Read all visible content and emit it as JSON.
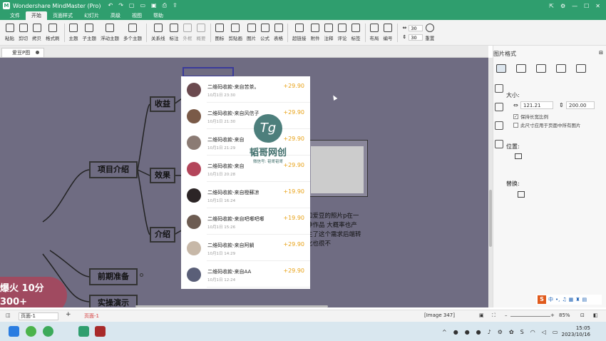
{
  "window": {
    "title": "Wondershare MindMaster (Pro)",
    "logo_letter": "M"
  },
  "menu": {
    "tabs": [
      "文件",
      "开始",
      "页面样式",
      "幻灯片",
      "高级",
      "视图",
      "帮助"
    ],
    "active": "开始"
  },
  "ribbon": {
    "groups": [
      [
        "粘贴",
        "剪切",
        "拷贝",
        "格式刷"
      ],
      [
        "主题",
        "子主题",
        "浮动主题",
        "多个主题"
      ],
      [
        "关系线",
        "标注",
        "外框",
        "概要"
      ],
      [
        "图标",
        "剪贴画",
        "图片",
        "公式",
        "表格"
      ],
      [
        "超链接",
        "附件",
        "注释",
        "评论",
        "标签"
      ],
      [
        "布局",
        "编号"
      ]
    ],
    "disabled": [
      "外框",
      "概要"
    ],
    "spin1": "30",
    "spin2": "30",
    "reset_label": "重置"
  },
  "document": {
    "tab_label": "爱豆P图"
  },
  "mindmap": {
    "root_line1": "爆火  10分",
    "root_line2": "300+",
    "topics": [
      "项目介绍",
      "前期准备",
      "实操演示"
    ],
    "subtopics": [
      "收益",
      "效果",
      "介绍"
    ],
    "note_text": "如爱豆的照片p在一种作品 大概率也产生了这个需求后端转化也很不"
  },
  "payments": [
    {
      "title": "二维码收款-来自苦茶。",
      "date": "10月1日 23:30",
      "amount": "+29.90",
      "avatar_color": "#6b4a4f"
    },
    {
      "title": "二维码收款-来自风信子",
      "date": "10月1日 21:30",
      "amount": "+29.90",
      "avatar_color": "#7a5a48"
    },
    {
      "title": "二维码收款-来自",
      "date": "10月1日 21:29",
      "amount": "+29.90",
      "avatar_color": "#8b7b74"
    },
    {
      "title": "二维码收款-来自",
      "date": "10月1日 20:28",
      "amount": "+29.90",
      "avatar_color": "#b3455a"
    },
    {
      "title": "二维码收款-来自橙蘇凉",
      "date": "10月1日 16:24",
      "amount": "+19.90",
      "avatar_color": "#2c2526"
    },
    {
      "title": "二维码收款-来自吧唧吧唧",
      "date": "10月1日 15:26",
      "amount": "+19.90",
      "avatar_color": "#6d5c52"
    },
    {
      "title": "二维码收款-来自阿躺",
      "date": "10月1日 14:29",
      "amount": "+29.90",
      "avatar_color": "#c7b8a8"
    },
    {
      "title": "二维码收款-来自AA",
      "date": "10月1日 12:24",
      "amount": "+29.90",
      "avatar_color": "#5a5f78"
    }
  ],
  "watermark": {
    "logo": "Tg",
    "name": "韬哥网创",
    "sub": "微信号: 韬哥韬哥"
  },
  "panel": {
    "title": "图片格式",
    "size_label": "大小:",
    "width": "121.21",
    "height": "200.00",
    "keep_ratio": "保持长宽比例",
    "apply_all": "此尺寸应用于页面中所有图片",
    "position_label": "位置:",
    "replace_label": "替换:"
  },
  "ime": {
    "icon": "S",
    "text": "中"
  },
  "status": {
    "page_select": "页面-1",
    "page_tab": "页面-1",
    "image_info": "[Image 347]",
    "zoom": "85%"
  },
  "taskbar": {
    "time": "15:05",
    "date": "2023/10/16"
  }
}
